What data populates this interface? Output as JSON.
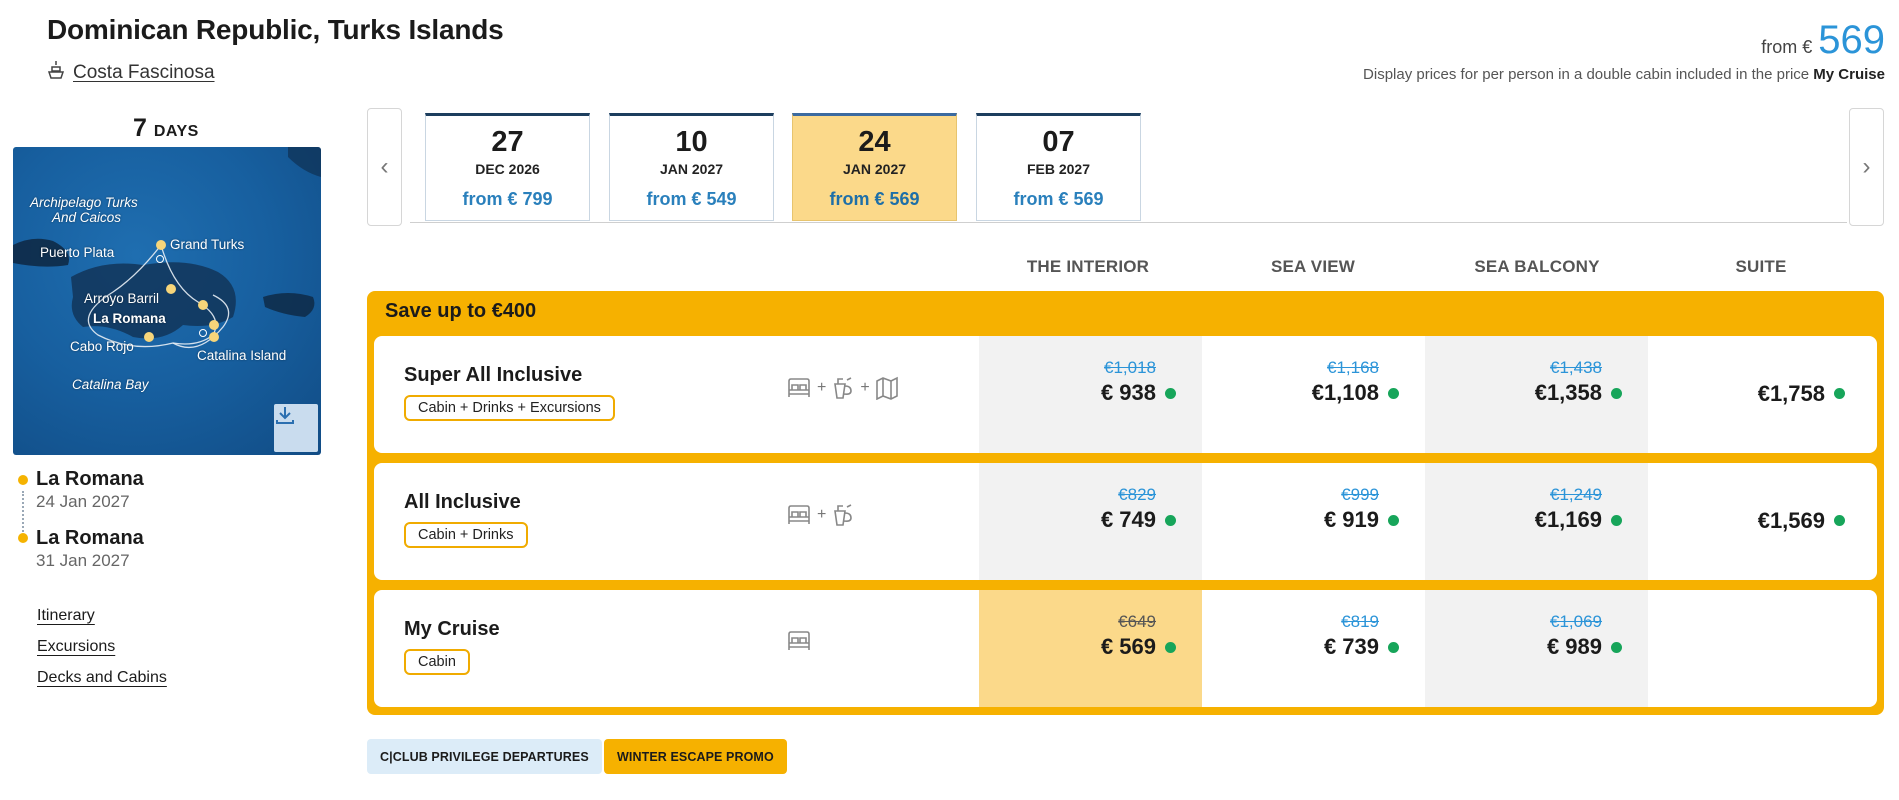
{
  "header": {
    "title": "Dominican Republic, Turks Islands",
    "ship_name": "Costa Fascinosa",
    "from_label": "from €",
    "from_price": "569",
    "disclaimer_text": "Display prices for per person in a double cabin included in the price",
    "disclaimer_bold": "My Cruise"
  },
  "sidebar": {
    "days_number": "7",
    "days_label": "DAYS",
    "map_labels": {
      "archipelago_1": "Archipelago Turks",
      "archipelago_2": "And Caicos",
      "puerto_plata": "Puerto Plata",
      "grand_turks": "Grand Turks",
      "arroyo_barril": "Arroyo Barril",
      "la_romana": "La Romana",
      "cabo_rojo": "Cabo Rojo",
      "catalina_island": "Catalina Island",
      "catalina_bay": "Catalina Bay"
    },
    "departure": {
      "port": "La Romana",
      "date": "24 Jan 2027"
    },
    "arrival": {
      "port": "La Romana",
      "date": "31 Jan 2027"
    },
    "links": [
      "Itinerary",
      "Excursions",
      "Decks and Cabins"
    ]
  },
  "dates": [
    {
      "day": "27",
      "month": "DEC 2026",
      "price": "from € 799",
      "selected": false
    },
    {
      "day": "10",
      "month": "JAN 2027",
      "price": "from € 549",
      "selected": false
    },
    {
      "day": "24",
      "month": "JAN 2027",
      "price": "from € 569",
      "selected": true
    },
    {
      "day": "07",
      "month": "FEB 2027",
      "price": "from € 569",
      "selected": false
    }
  ],
  "columns": [
    "THE INTERIOR",
    "SEA VIEW",
    "SEA BALCONY",
    "SUITE"
  ],
  "offer": {
    "headline": "Save up to €400",
    "packages": [
      {
        "name": "Super All Inclusive",
        "tag": "Cabin + Drinks + Excursions",
        "icons": [
          "bed-icon",
          "drink-icon",
          "map-icon"
        ],
        "prices": [
          {
            "old": "€1,018",
            "now": "€ 938"
          },
          {
            "old": "€1,168",
            "now": "€1,108"
          },
          {
            "old": "€1,438",
            "now": "€1,358"
          },
          {
            "old": "",
            "now": "€1,758"
          }
        ]
      },
      {
        "name": "All Inclusive",
        "tag": "Cabin + Drinks",
        "icons": [
          "bed-icon",
          "drink-icon"
        ],
        "prices": [
          {
            "old": "€829",
            "now": "€ 749"
          },
          {
            "old": "€999",
            "now": "€ 919"
          },
          {
            "old": "€1,249",
            "now": "€1,169"
          },
          {
            "old": "",
            "now": "€1,569"
          }
        ]
      },
      {
        "name": "My Cruise",
        "tag": "Cabin",
        "icons": [
          "bed-icon"
        ],
        "prices": [
          {
            "old": "€649",
            "now": "€ 569"
          },
          {
            "old": "€819",
            "now": "€ 739"
          },
          {
            "old": "€1,069",
            "now": "€ 989"
          },
          {
            "old": "",
            "now": ""
          }
        ]
      }
    ]
  },
  "badges": {
    "club": "C|CLUB PRIVILEGE DEPARTURES",
    "promo": "WINTER ESCAPE PROMO"
  },
  "colors": {
    "accent": "#f6b100",
    "selected": "#fbd98a",
    "price_blue": "#2b94d8",
    "available_dot": "#17a55a"
  }
}
